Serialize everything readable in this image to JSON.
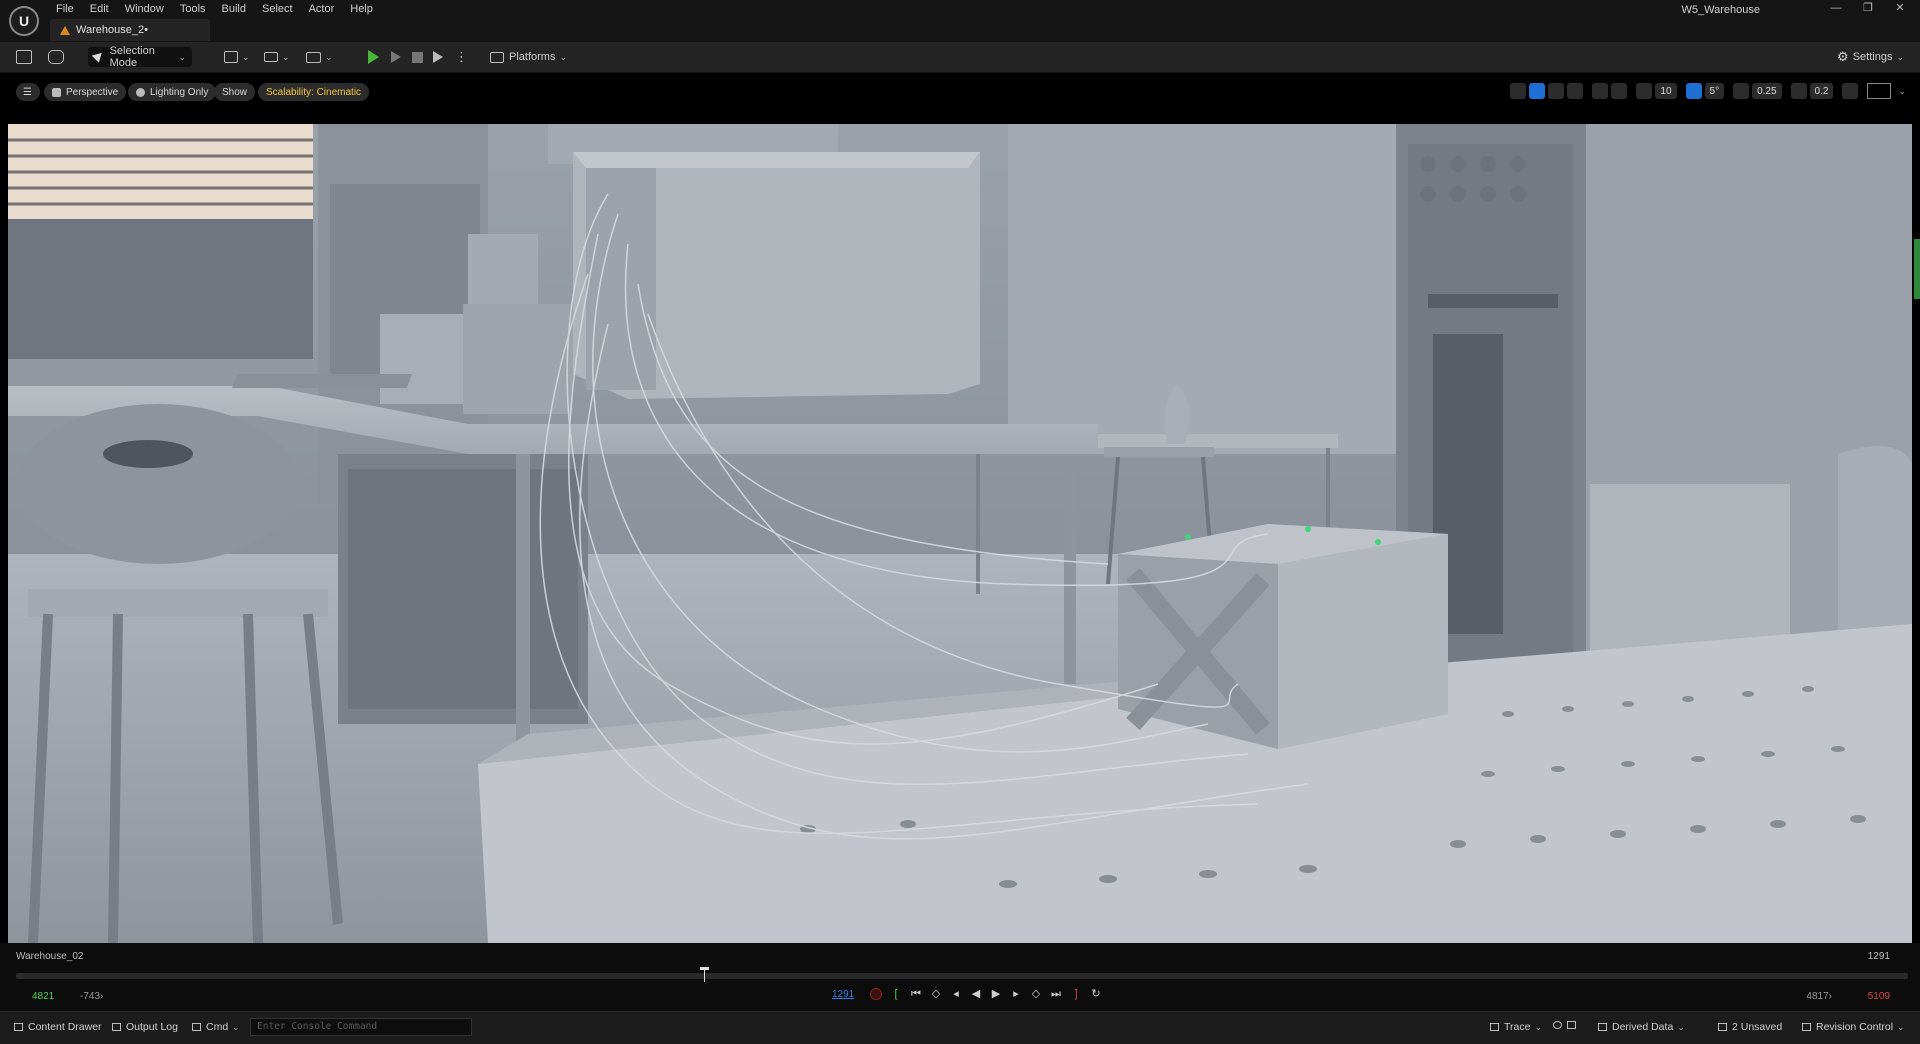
{
  "app": {
    "logo_text": "U",
    "project_name": "W5_Warehouse",
    "menu": [
      "File",
      "Edit",
      "Window",
      "Tools",
      "Build",
      "Select",
      "Actor",
      "Help"
    ],
    "document_tab": "Warehouse_2•",
    "window_controls": [
      "—",
      "❐",
      "✕"
    ]
  },
  "toolbar": {
    "mode": "Selection Mode",
    "platforms": "Platforms",
    "settings": "Settings",
    "play_color": "#49b53a"
  },
  "viewport": {
    "perspective": "Perspective",
    "view_mode": "Lighting Only",
    "show": "Show",
    "scalability": "Scalability: Cinematic",
    "grid_snap": "10",
    "rotation_snap": "5°",
    "scale_snap": "0.25",
    "camera_speed": "0.2",
    "accent": "#1f6ed4"
  },
  "sequencer": {
    "sequence_name": "Warehouse_02",
    "frame_right": "1291",
    "range_in": "4821",
    "range_start": "-743›",
    "current_frame": "1291",
    "range_end": "4817›",
    "range_out": "5109"
  },
  "statusbar": {
    "content_drawer": "Content Drawer",
    "output_log": "Output Log",
    "cmd": "Cmd",
    "console_placeholder": "Enter Console Command",
    "trace": "Trace",
    "derived_data": "Derived Data",
    "unsaved": "2 Unsaved",
    "revision_control": "Revision Control"
  }
}
